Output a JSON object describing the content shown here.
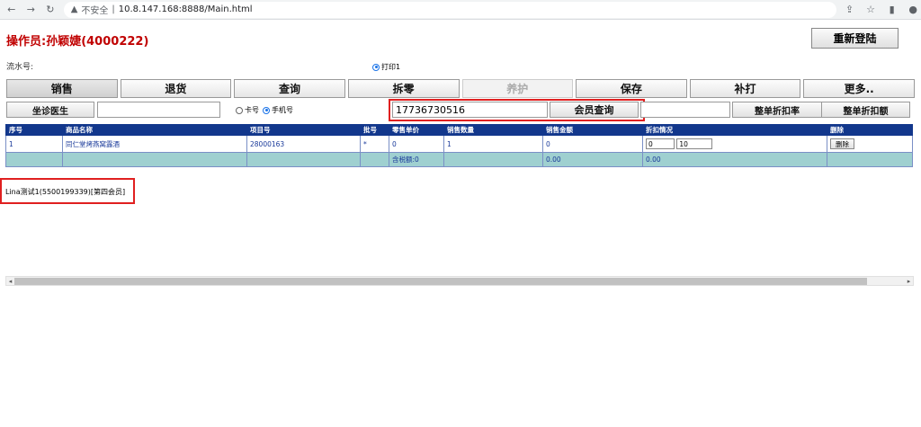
{
  "browser": {
    "insecure_label": "不安全",
    "url": "10.8.147.168:8888/Main.html"
  },
  "header": {
    "operator": "操作员:孙颖婕(4000222)",
    "relogin": "重新登陆",
    "serial_label": "流水号:",
    "print_option": "打印1"
  },
  "tabs": [
    {
      "label": "销售",
      "state": "active"
    },
    {
      "label": "退货",
      "state": "normal"
    },
    {
      "label": "查询",
      "state": "normal"
    },
    {
      "label": "拆零",
      "state": "normal"
    },
    {
      "label": "养护",
      "state": "disabled"
    },
    {
      "label": "保存",
      "state": "normal"
    },
    {
      "label": "补打",
      "state": "normal"
    },
    {
      "label": "更多..",
      "state": "normal"
    }
  ],
  "toolbar": {
    "doctor_button": "坐诊医生",
    "doctor_input": "",
    "card_option": "卡号",
    "phone_option": "手机号",
    "member_input": "17736730516",
    "member_query": "会员查询",
    "discount_input": "",
    "discount_rate": "整单折扣率",
    "discount_amount": "整单折扣额"
  },
  "table": {
    "headers": [
      "序号",
      "商品名称",
      "项目号",
      "批号",
      "零售单价",
      "销售数量",
      "销售金额",
      "折扣情况",
      "删除"
    ],
    "rows": [
      {
        "index": "1",
        "name": "同仁堂烤燕窝露酒",
        "item_no": "28000163",
        "batch": "*",
        "price": "0",
        "qty": "1",
        "amount": "0",
        "discount_a": "0",
        "discount_b": "10",
        "delete": "删除"
      }
    ],
    "total": {
      "tax_label": "含税额:0",
      "amount": "0.00",
      "discount": "0.00"
    }
  },
  "member_info": "Lina测试1(5500199339)[第四会员]",
  "colors": {
    "accent_red": "#c00000",
    "header_blue": "#12378c",
    "total_teal": "#9fd0d0",
    "highlight": "#e02020"
  }
}
